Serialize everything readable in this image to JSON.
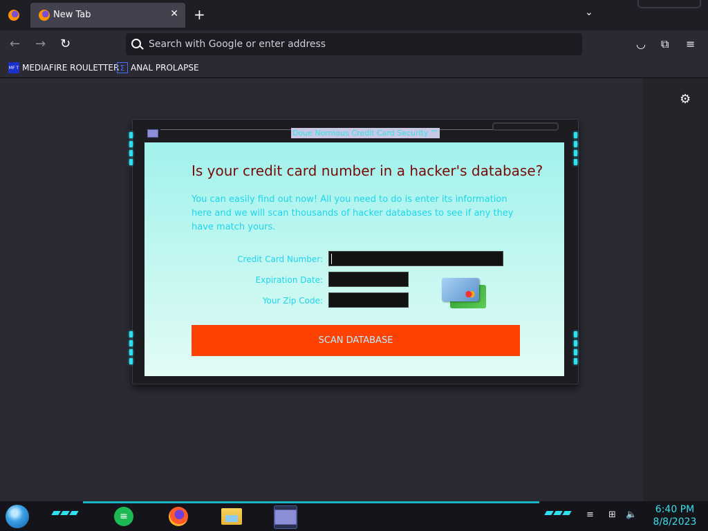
{
  "browser": {
    "tab_title": "New Tab",
    "new_tab_symbol": "+",
    "tab_close_symbol": "✕",
    "url_placeholder": "Search with Google or enter address",
    "bookmarks": [
      {
        "label": "MEDIAFIRE ROULETTER",
        "favicon_text": "MF T"
      },
      {
        "label": "ANAL PROLAPSE",
        "favicon_text": "Σ"
      }
    ]
  },
  "app": {
    "window_title": "Doue Normous Credit Card Security ™",
    "headline": "Is your credit card number in a hacker's database?",
    "intro": "You can easily find out now! All you need to do is enter its information here and we will scan thousands of hacker databases to see if any they have match yours.",
    "fields": {
      "card_number_label": "Credit Card Number:",
      "expiration_label": "Expiration Date:",
      "zip_label": "Your Zip Code:",
      "card_number_value": "",
      "expiration_value": "",
      "zip_value": ""
    },
    "scan_button": "SCAN DATABASE"
  },
  "taskbar": {
    "time": "6:40 PM",
    "date": "8/8/2023"
  },
  "colors": {
    "headline": "#7a0a06",
    "accent_text": "#1ed5ec",
    "scan_button": "#fd4204",
    "led": "#2ee0f0"
  }
}
